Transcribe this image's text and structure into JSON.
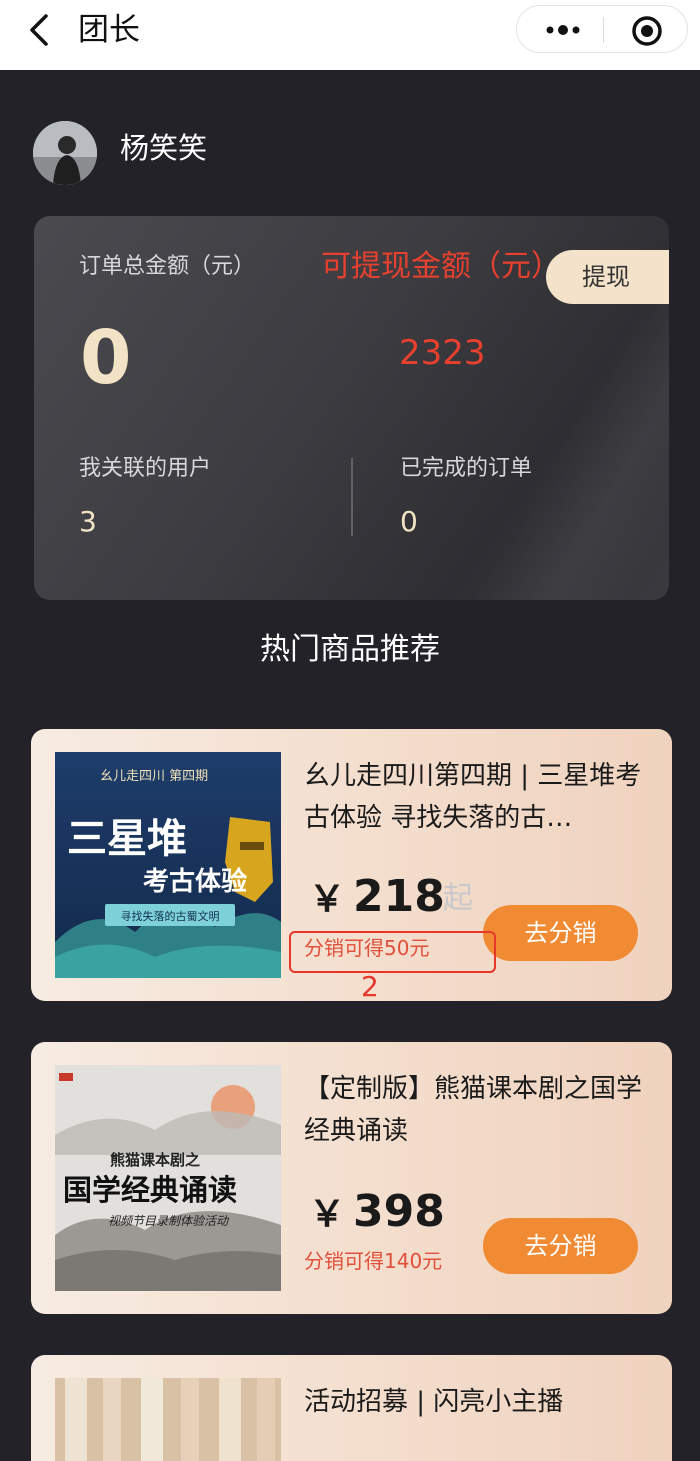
{
  "nav": {
    "title": "团长",
    "back_icon": "chevron-left-icon",
    "more_icon": "more-dots-icon",
    "target_icon": "target-icon"
  },
  "user": {
    "name": "杨笑笑"
  },
  "stats": {
    "total_orders_label": "订单总金额（元）",
    "total_orders_value": "0",
    "withdrawable_label": "可提现金额（元）",
    "withdrawable_value": "2323",
    "withdraw_button": "提现",
    "linked_users_label": "我关联的用户",
    "linked_users_value": "3",
    "completed_orders_label": "已完成的订单",
    "completed_orders_value": "0"
  },
  "section_title": "热门商品推荐",
  "products": [
    {
      "title": "幺儿走四川第四期 | 三星堆考古体验 寻找失落的古…",
      "price": "218",
      "price_suffix": "起",
      "commission": "分销可得50元",
      "button": "去分销",
      "image": {
        "top": "幺儿走四川 第四期",
        "main1": "三星堆",
        "main2": "考古体验",
        "tag": "寻找失落的古蜀文明"
      }
    },
    {
      "title": "【定制版】熊猫课本剧之国学经典诵读",
      "price": "398",
      "price_suffix": "",
      "commission": "分销可得140元",
      "button": "去分销",
      "image": {
        "top": "熊猫课本剧之",
        "main1": "国学经典诵读",
        "main2": "视频节目录制体验活动"
      }
    },
    {
      "title": "活动招募 | 闪亮小主播"
    }
  ],
  "annotation": {
    "number": "2"
  },
  "currency_symbol": "￥",
  "colors": {
    "background": "#232228",
    "accent_orange": "#f08b33",
    "gold_text": "#f3e3c6",
    "red_text": "#e8402e"
  }
}
